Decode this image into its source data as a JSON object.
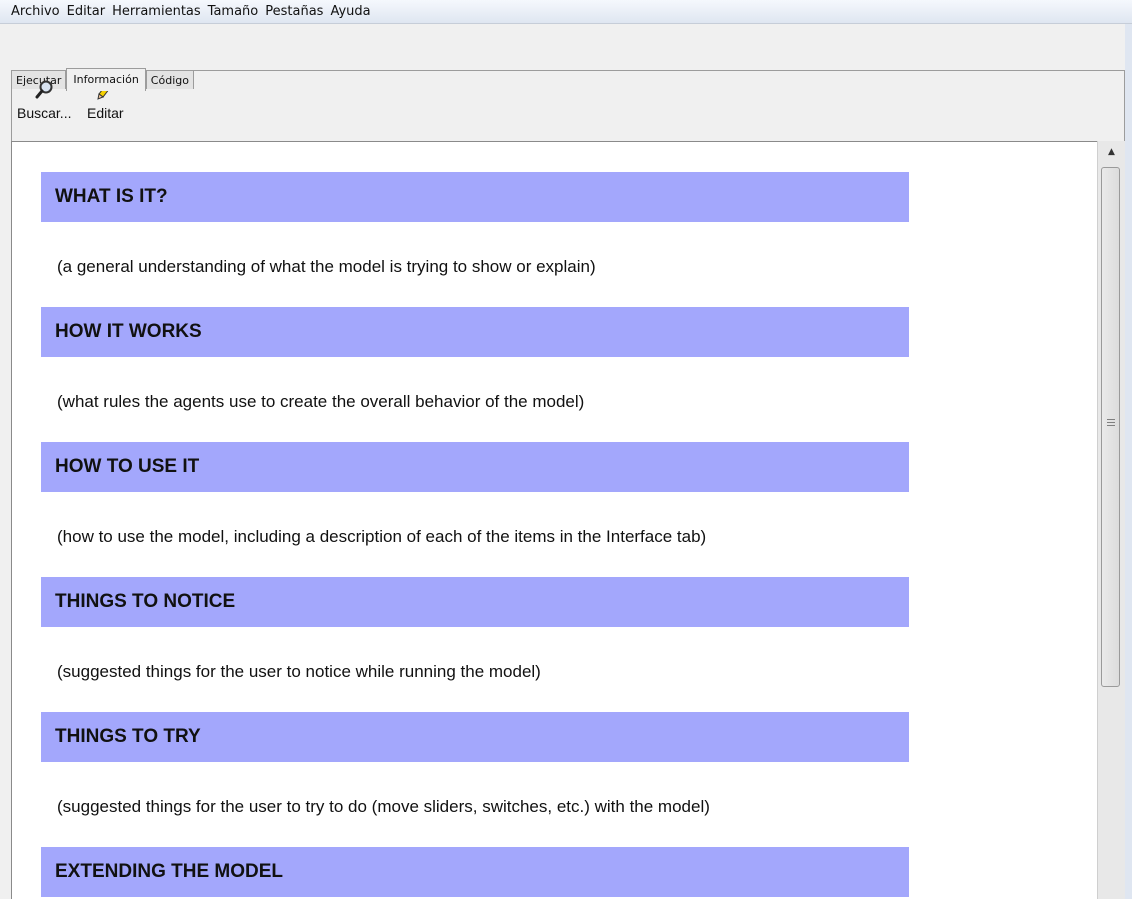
{
  "menubar": {
    "items": [
      "Archivo",
      "Editar",
      "Herramientas",
      "Tamaño",
      "Pestañas",
      "Ayuda"
    ]
  },
  "tabs": [
    {
      "label": "Ejecutar",
      "selected": false
    },
    {
      "label": "Información",
      "selected": true
    },
    {
      "label": "Código",
      "selected": false
    }
  ],
  "toolbar": {
    "find_label": "Buscar...",
    "find_icon": "magnifier-icon",
    "edit_label": "Editar",
    "edit_icon": "pencil-icon"
  },
  "content": {
    "heading_color": "#a3a7fc",
    "sections": [
      {
        "heading": "WHAT IS IT?",
        "text": "(a general understanding of what the model is trying to show or explain)"
      },
      {
        "heading": "HOW IT WORKS",
        "text": "(what rules the agents use to create the overall behavior of the model)"
      },
      {
        "heading": "HOW TO USE IT",
        "text": "(how to use the model, including a description of each of the items in the Interface tab)"
      },
      {
        "heading": "THINGS TO NOTICE",
        "text": "(suggested things for the user to notice while running the model)"
      },
      {
        "heading": "THINGS TO TRY",
        "text": "(suggested things for the user to try to do (move sliders, switches, etc.) with the model)"
      },
      {
        "heading": "EXTENDING THE MODEL",
        "text": ""
      }
    ]
  }
}
